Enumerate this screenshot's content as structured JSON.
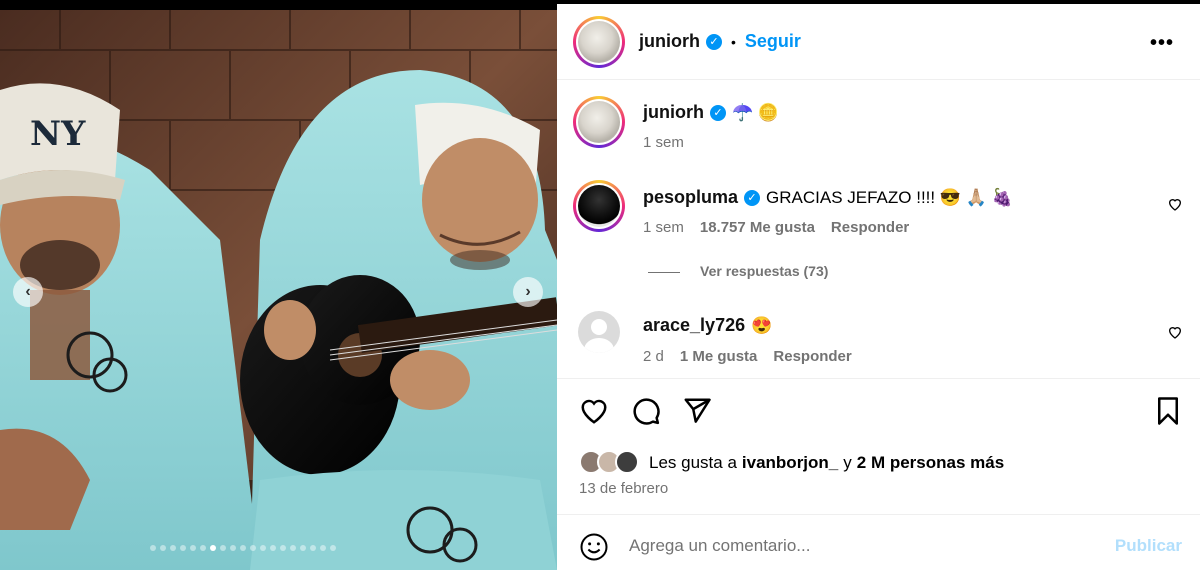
{
  "post": {
    "author": "juniorh",
    "follow_label": "Seguir",
    "more_label": "•••",
    "dot_separator": "•",
    "caption": {
      "author": "juniorh",
      "emoji": "☂️ 🪙",
      "time": "1 sem"
    }
  },
  "media": {
    "prev_label": "‹",
    "next_label": "›",
    "carousel_total": 19,
    "carousel_active_index": 6
  },
  "comments": [
    {
      "author": "pesopluma",
      "text": "GRACIAS JEFAZO !!!! 😎 🙏🏼 🍇",
      "time": "1 sem",
      "likes": "18.757 Me gusta",
      "reply_label": "Responder",
      "view_replies": "Ver respuestas (73)"
    },
    {
      "author": "arace_ly726",
      "text": "😍",
      "time": "2 d",
      "likes": "1 Me gusta",
      "reply_label": "Responder"
    }
  ],
  "likes_line": {
    "prefix": "Les gusta a",
    "user": "ivanborjon_",
    "conj": "y",
    "rest": "2 M personas más"
  },
  "date": "13 de febrero",
  "comment_input": {
    "placeholder": "Agrega un comentario...",
    "publish_label": "Publicar"
  },
  "colors": {
    "accent": "#0095f6",
    "hoodie": "#9ad9dc",
    "wood": "#6b4431"
  }
}
